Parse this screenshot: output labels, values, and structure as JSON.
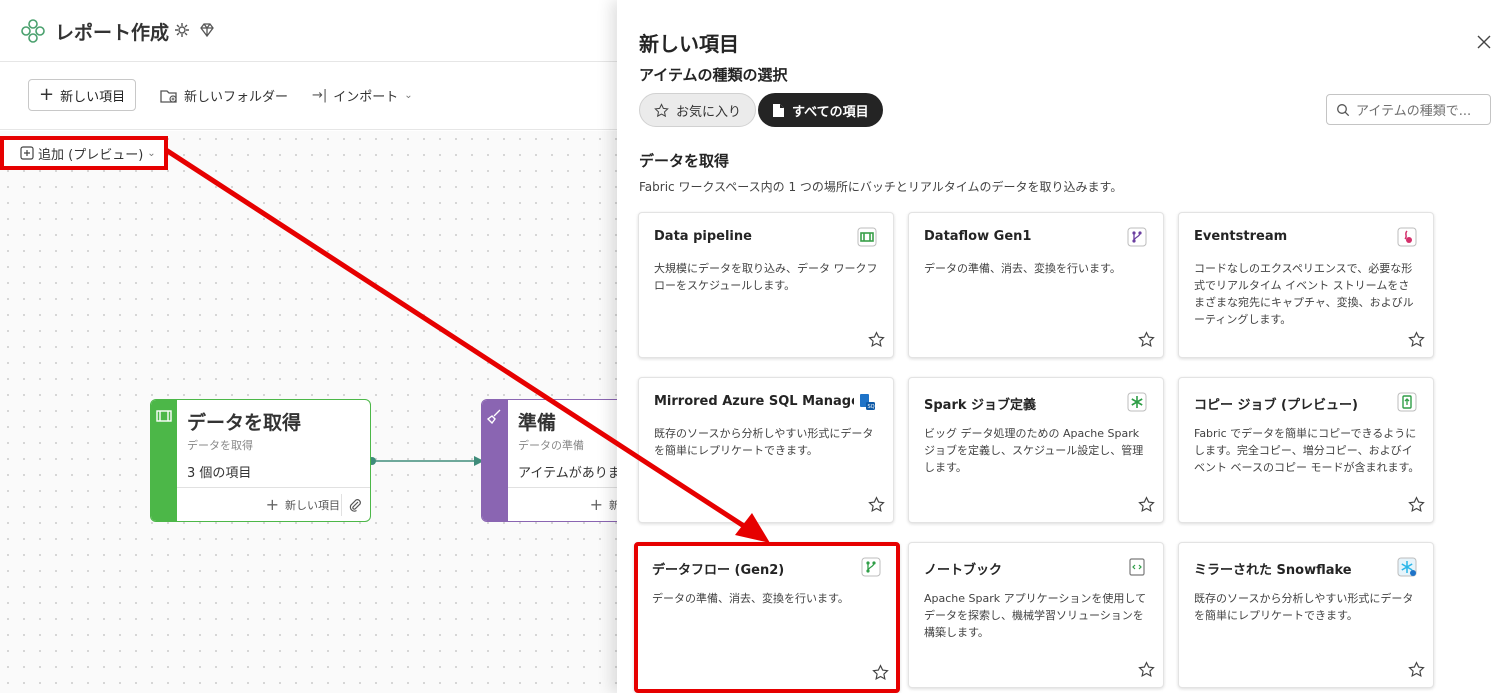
{
  "workspace": {
    "title": "レポート作成"
  },
  "toolbar": {
    "new_item": "新しい項目",
    "new_folder": "新しいフォルダー",
    "import": "インポート"
  },
  "canvas": {
    "add_label": "追加 (プレビュー)",
    "nodes": [
      {
        "title": "データを取得",
        "subtitle": "データを取得",
        "count": "3 個の項目",
        "add": "新しい項目",
        "color": "#4cb748"
      },
      {
        "title": "準備",
        "subtitle": "データの準備",
        "count": "アイテムがありま",
        "add": "新",
        "color": "#8a65b2"
      }
    ]
  },
  "panel": {
    "title": "新しい項目",
    "subtitle": "アイテムの種類の選択",
    "chips": {
      "favorites": "お気に入り",
      "all": "すべての項目"
    },
    "search_placeholder": "アイテムの種類で...",
    "section": {
      "title": "データを取得",
      "description": "Fabric ワークスペース内の 1 つの場所にバッチとリアルタイムのデータを取り込みます。"
    },
    "cards": [
      {
        "title": "Data pipeline",
        "description": "大規模にデータを取り込み、データ ワークフローをスケジュールします。",
        "icon": "pipeline-icon"
      },
      {
        "title": "Dataflow Gen1",
        "description": "データの準備、消去、変換を行います。",
        "icon": "dataflow-icon"
      },
      {
        "title": "Eventstream",
        "description": "コードなしのエクスペリエンスで、必要な形式でリアルタイム イベント ストリームをさまざまな宛先にキャプチャ、変換、およびルーティングします。",
        "icon": "eventstream-icon"
      },
      {
        "title": "Mirrored Azure SQL Managed ...",
        "description": "既存のソースから分析しやすい形式にデータを簡単にレプリケートできます。",
        "icon": "mirrored-sql-icon"
      },
      {
        "title": "Spark ジョブ定義",
        "description": "ビッグ データ処理のための Apache Spark ジョブを定義し、スケジュール設定し、管理します。",
        "icon": "spark-job-icon"
      },
      {
        "title": "コピー ジョブ (プレビュー)",
        "description": "Fabric でデータを簡単にコピーできるようにします。完全コピー、増分コピー、およびイベント ベースのコピー モードが含まれます。",
        "icon": "copy-job-icon"
      },
      {
        "title": "データフロー (Gen2)",
        "description": "データの準備、消去、変換を行います。",
        "icon": "dataflow-gen2-icon"
      },
      {
        "title": "ノートブック",
        "description": "Apache Spark アプリケーションを使用してデータを探索し、機械学習ソリューションを構築します。",
        "icon": "notebook-icon"
      },
      {
        "title": "ミラーされた Snowflake",
        "description": "既存のソースから分析しやすい形式にデータを簡単にレプリケートできます。",
        "icon": "snowflake-icon"
      }
    ]
  },
  "colors": {
    "highlight": "#e60000",
    "green": "#4cb748",
    "purple": "#8a65b2",
    "connector": "#3f8c7a"
  }
}
